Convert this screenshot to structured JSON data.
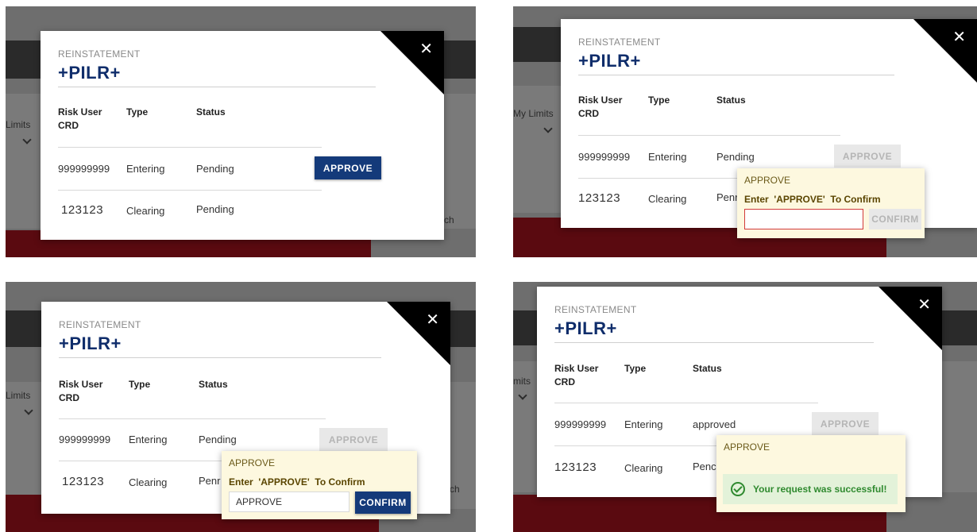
{
  "modal": {
    "eyebrow": "REINSTATEMENT",
    "title": "+PILR+",
    "columns": {
      "risk_user": "Risk User\nCRD",
      "type": "Type",
      "status": "Status"
    },
    "approve_label": "APPROVE"
  },
  "panels": [
    {
      "rows": [
        {
          "crd": "999999999",
          "type": "Entering",
          "status": "Pending"
        },
        {
          "crd": "123123",
          "type": "Clearing",
          "status": "Pending"
        }
      ],
      "background": {
        "left_label": "Limits",
        "right_label": "ch"
      }
    },
    {
      "rows": [
        {
          "crd": "999999999",
          "type": "Entering",
          "status": "Pending"
        },
        {
          "crd": "123123",
          "type": "Clearing",
          "status": "Penr"
        }
      ],
      "popover": {
        "title": "APPROVE",
        "instruction": "Enter  'APPROVE'  To Confirm",
        "input_value": "",
        "confirm_label": "CONFIRM"
      },
      "background": {
        "left_label": "My Limits",
        "right_label": "ch"
      }
    },
    {
      "rows": [
        {
          "crd": "999999999",
          "type": "Entering",
          "status": "Pending"
        },
        {
          "crd": "123123",
          "type": "Clearing",
          "status": "Penr"
        }
      ],
      "popover": {
        "title": "APPROVE",
        "instruction": "Enter  'APPROVE'  To Confirm",
        "input_value": "APPROVE",
        "confirm_label": "CONFIRM"
      },
      "background": {
        "left_label": "Limits",
        "right_label": "ch"
      }
    },
    {
      "rows": [
        {
          "crd": "999999999",
          "type": "Entering",
          "status": "approved"
        },
        {
          "crd": "123123",
          "type": "Clearing",
          "status": "Penc"
        }
      ],
      "popover": {
        "title": "APPROVE",
        "success_message": "Your request was successful!"
      },
      "background": {
        "left_label": "mits",
        "right_label": "ch"
      }
    }
  ]
}
